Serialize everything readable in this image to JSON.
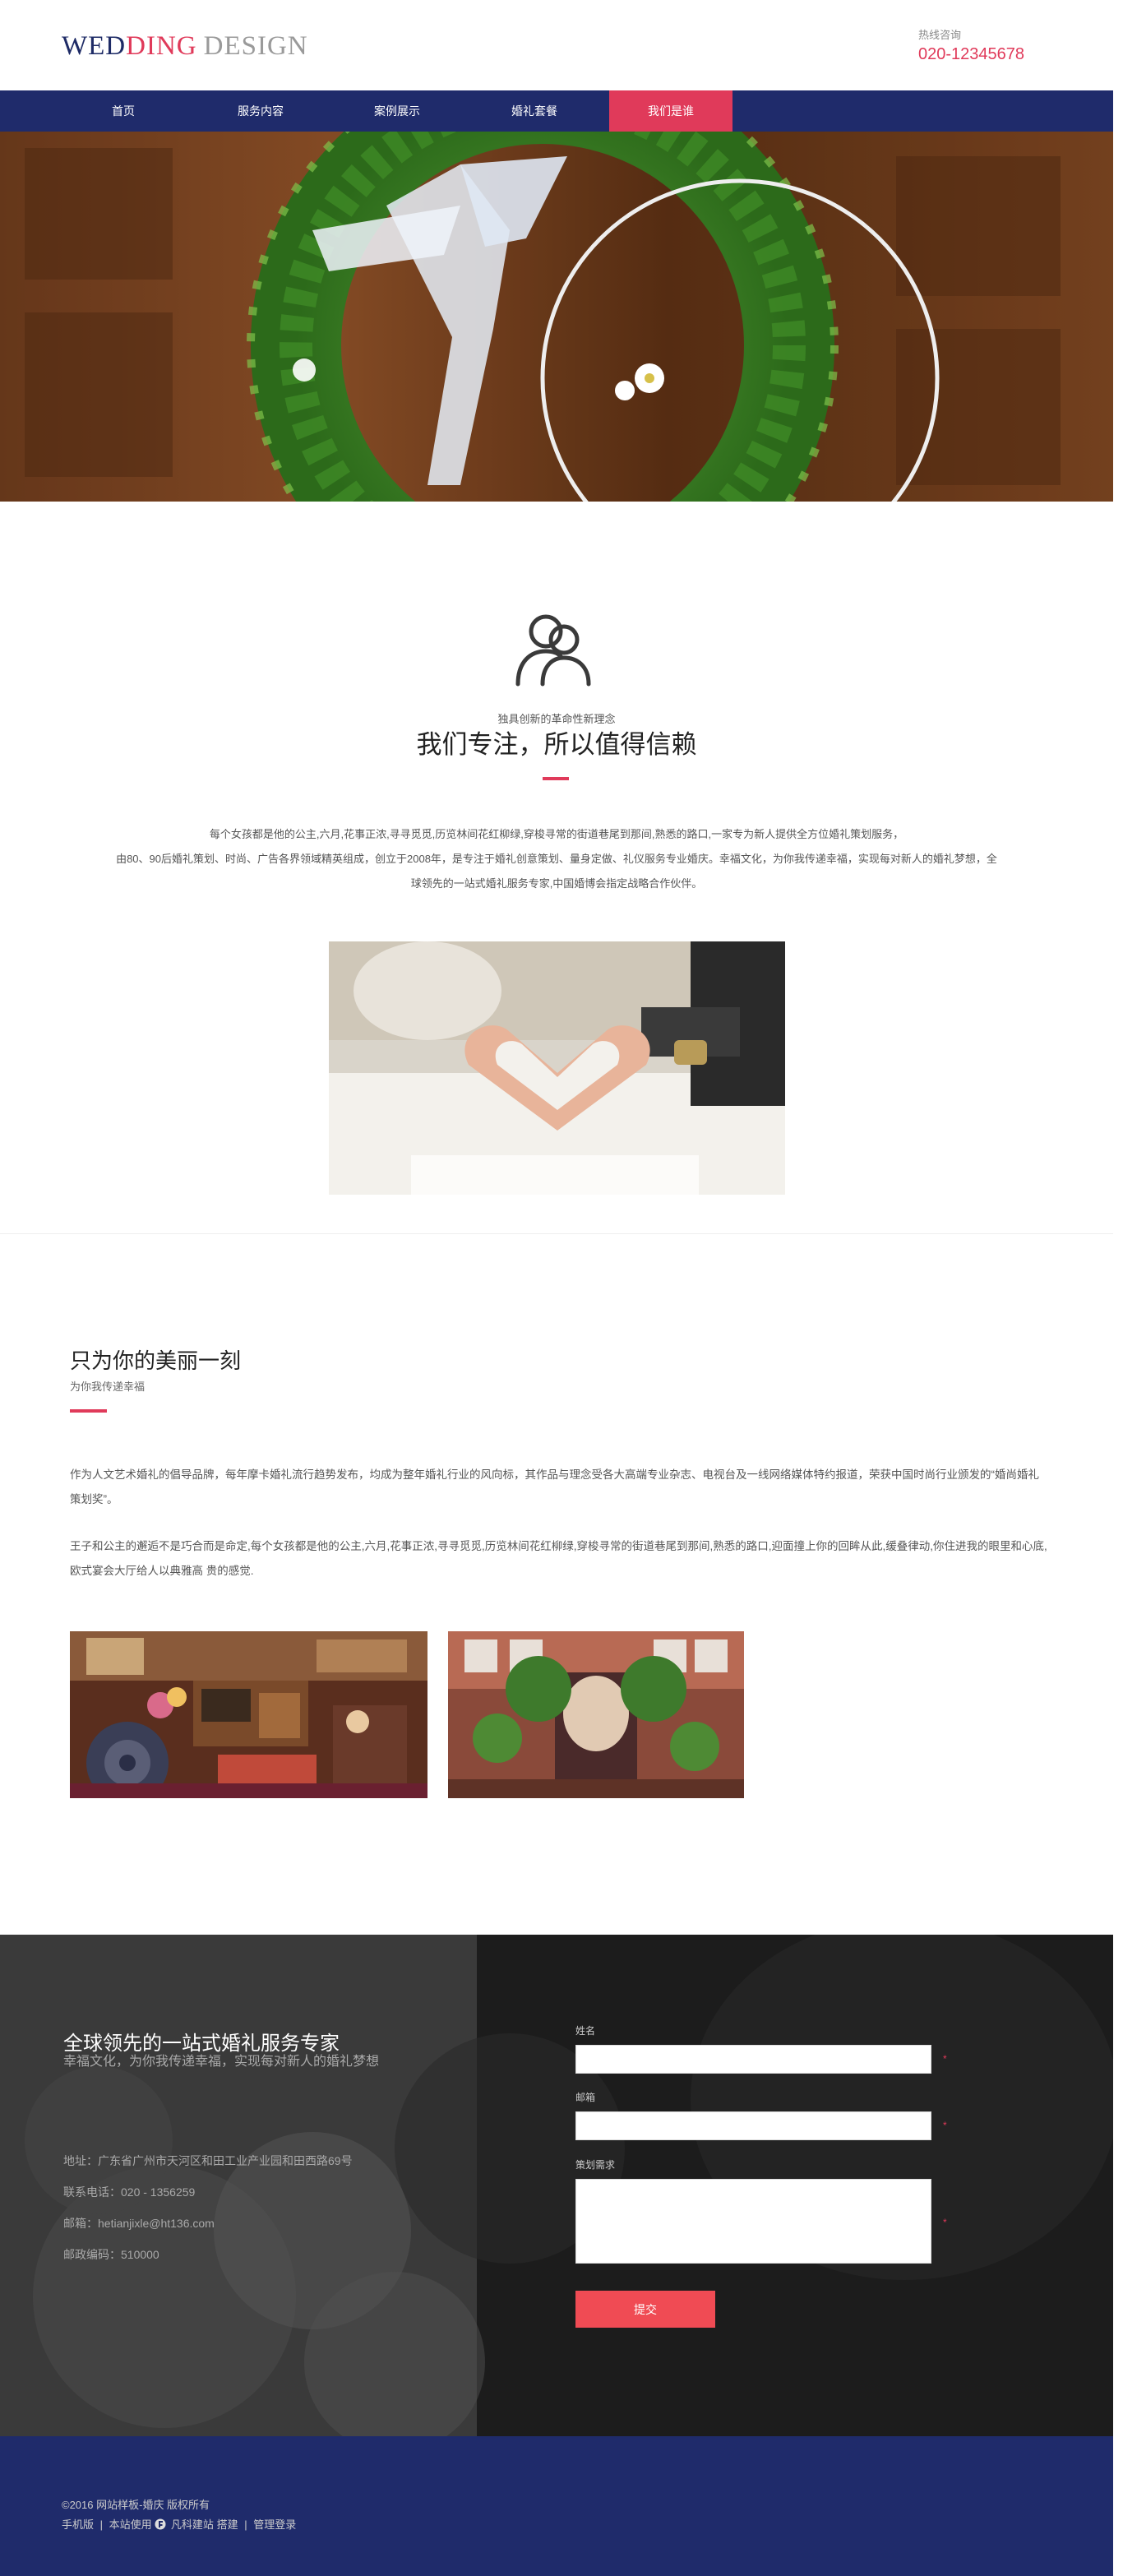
{
  "header": {
    "logo_part1": "WED",
    "logo_part2": "DING",
    "logo_part3": "DESIGN",
    "hotline_label": "热线咨询",
    "hotline_phone": "020-12345678"
  },
  "nav": {
    "items": [
      {
        "label": "首页"
      },
      {
        "label": "服务内容"
      },
      {
        "label": "案例展示"
      },
      {
        "label": "婚礼套餐"
      },
      {
        "label": "我们是谁"
      }
    ],
    "active_index": 4
  },
  "intro": {
    "icon": "people-icon",
    "kicker": "独具创新的革命性新理念",
    "heading": "我们专注，所以值得信赖",
    "desc_line1": "每个女孩都是他的公主,六月,花事正浓,寻寻觅觅,历览林间花红柳绿,穿梭寻常的街道巷尾到那间,熟悉的路口,一家专为新人提供全方位婚礼策划服务，",
    "desc_line2": "由80、90后婚礼策划、时尚、广告各界领域精英组成，创立于2008年，是专注于婚礼创意策划、量身定做、礼仪服务专业婚庆。幸福文化，为你我传递幸福，实现每对新人的婚礼梦想，全",
    "desc_line3": "球领先的一站式婚礼服务专家,中国婚博会指定战略合作伙伴。"
  },
  "moment": {
    "title": "只为你的美丽一刻",
    "subtitle": "为你我传递幸福",
    "para1": "作为人文艺术婚礼的倡导品牌，每年摩卡婚礼流行趋势发布，均成为整年婚礼行业的风向标，其作品与理念受各大高端专业杂志、电视台及一线网络媒体特约报道，荣获中国时尚行业颁发的“婚尚婚礼策划奖”。",
    "para2": "王子和公主的邂逅不是巧合而是命定,每个女孩都是他的公主,六月,花事正浓,寻寻觅觅,历览林间花红柳绿,穿梭寻常的街道巷尾到那间,熟悉的路口,迎面撞上你的回眸从此,缓叠律动,你住进我的眼里和心底,欧式宴会大厅给人以典雅高 贵的感觉."
  },
  "contact": {
    "title": "全球领先的一站式婚礼服务专家",
    "subtitle": "幸福文化，为你我传递幸福，实现每对新人的婚礼梦想",
    "address": "地址：广东省广州市天河区和田工业产业园和田西路69号",
    "phone": "联系电话：020 - 1356259",
    "email": "邮箱：hetianjixle@ht136.com",
    "postcode": "邮政编码：510000",
    "form": {
      "name_label": "姓名",
      "name_value": "",
      "email_label": "邮箱",
      "email_value": "",
      "request_label": "策划需求",
      "request_value": "",
      "required_mark": "*",
      "submit_label": "提交"
    }
  },
  "footer": {
    "copyright": "©2016 网站样板-婚庆 版权所有",
    "mobile_link": "手机版",
    "powered_prefix": "本站使用",
    "powered_brand": "凡科建站",
    "powered_suffix": "搭建",
    "admin_link": "管理登录",
    "separator": "|"
  },
  "colors": {
    "navy": "#1f2b6b",
    "accent": "#e03a5a",
    "submit": "#f04b54"
  }
}
